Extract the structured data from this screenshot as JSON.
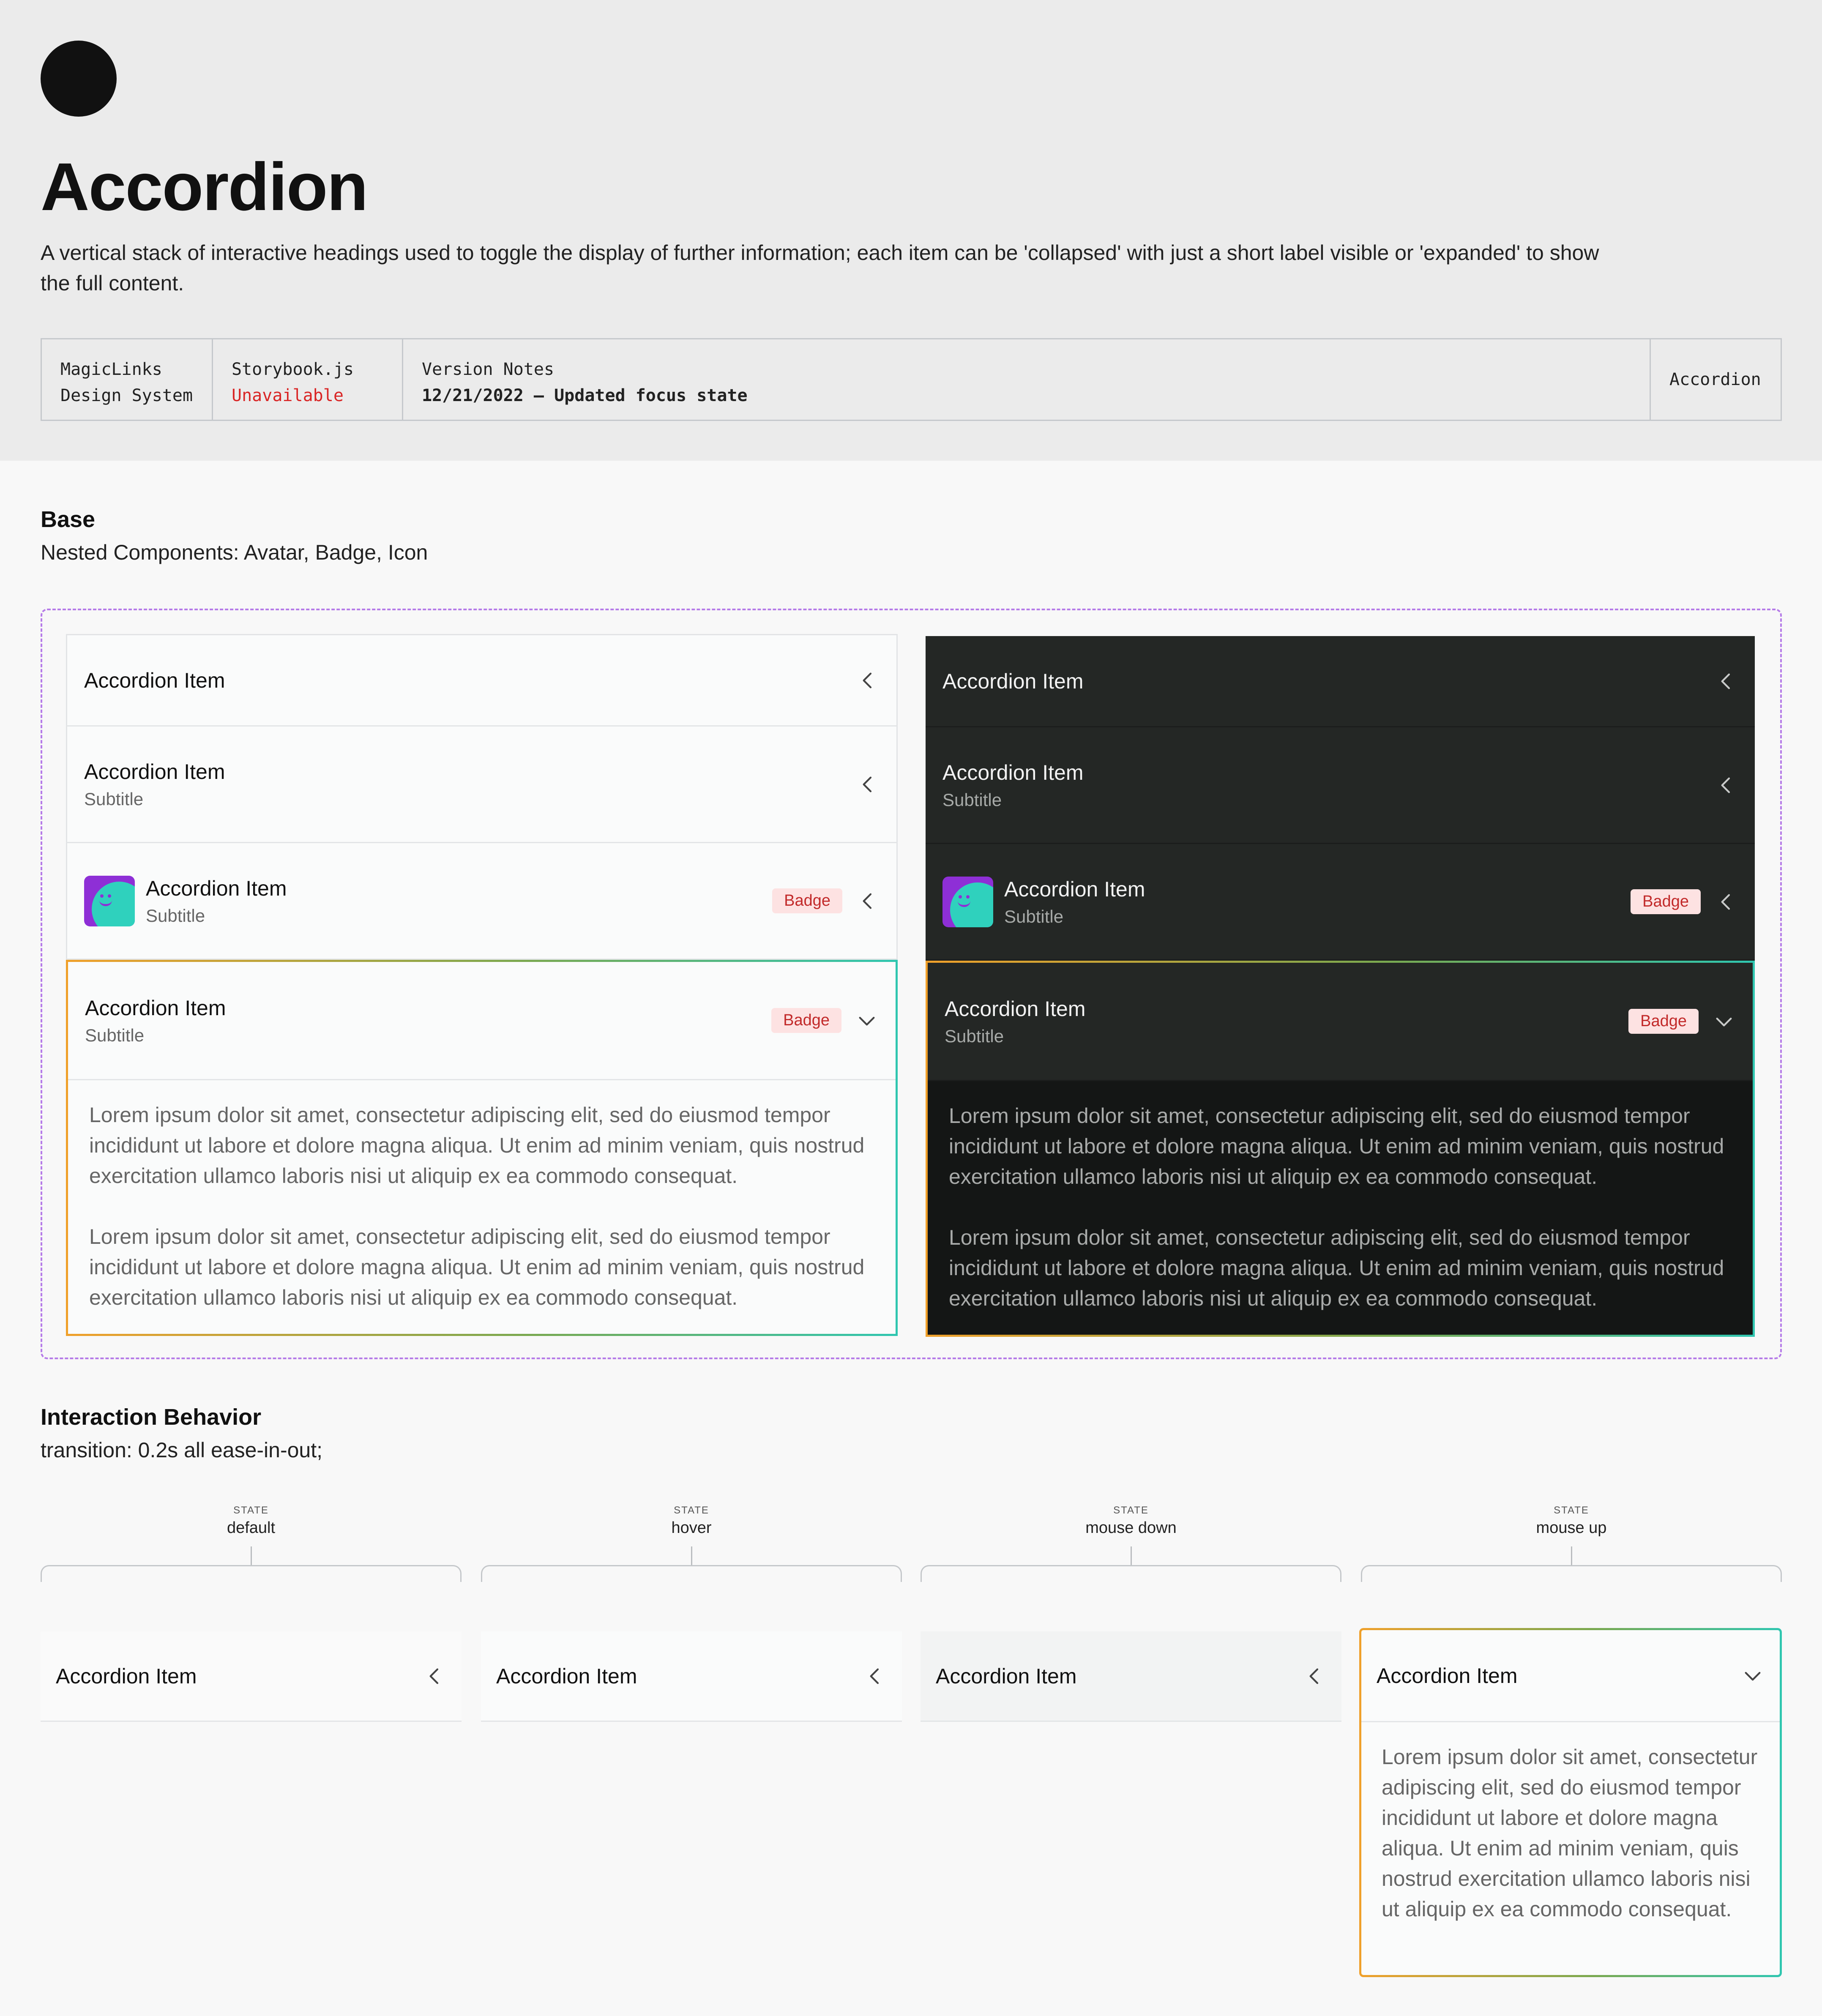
{
  "header": {
    "title": "Accordion",
    "description": "A vertical stack of interactive headings used to toggle the display of further information; each item can be 'collapsed' with just a short label visible or 'expanded' to show the full content.",
    "meta": {
      "system_line1": "MagicLinks",
      "system_line2": "Design System",
      "storybook_label": "Storybook.js",
      "storybook_status": "Unavailable",
      "notes_label": "Version Notes",
      "notes_value": "12/21/2022 – Updated focus state",
      "component": "Accordion"
    }
  },
  "base": {
    "title": "Base",
    "subtitle": "Nested Components: Avatar, Badge, Icon",
    "item_title": "Accordion Item",
    "item_subtitle": "Subtitle",
    "badge": "Badge",
    "paragraph": "Lorem ipsum dolor sit amet, consectetur adipiscing elit, sed do eiusmod tempor incididunt ut labore et dolore magna aliqua. Ut enim ad minim veniam, quis nostrud exercitation ullamco laboris nisi ut aliquip ex ea commodo consequat."
  },
  "interaction": {
    "title": "Interaction Behavior",
    "subtitle": "transition: 0.2s all ease-in-out;",
    "state_label": "STATE",
    "states": [
      "default",
      "hover",
      "mouse down",
      "mouse up"
    ],
    "item_title": "Accordion Item",
    "paragraph": "Lorem ipsum dolor sit amet, consectetur adipiscing elit, sed do eiusmod tempor incididunt ut labore et dolore magna aliqua. Ut enim ad minim veniam, quis nostrud exercitation ullamco laboris nisi ut aliquip ex ea commodo consequat."
  },
  "colors": {
    "header_bg": "#ebebeb",
    "page_bg": "#f8f8f8",
    "dark_bg": "#242725",
    "frame_dash": "#b57be8",
    "badge_bg": "#fde2e2",
    "badge_text": "#c22a2a",
    "focus_gradient": [
      "#f0a02a",
      "#2fc6b0"
    ],
    "unavailable": "#d92626"
  },
  "icons": [
    "chevron-left-icon",
    "chevron-down-icon",
    "avatar"
  ]
}
